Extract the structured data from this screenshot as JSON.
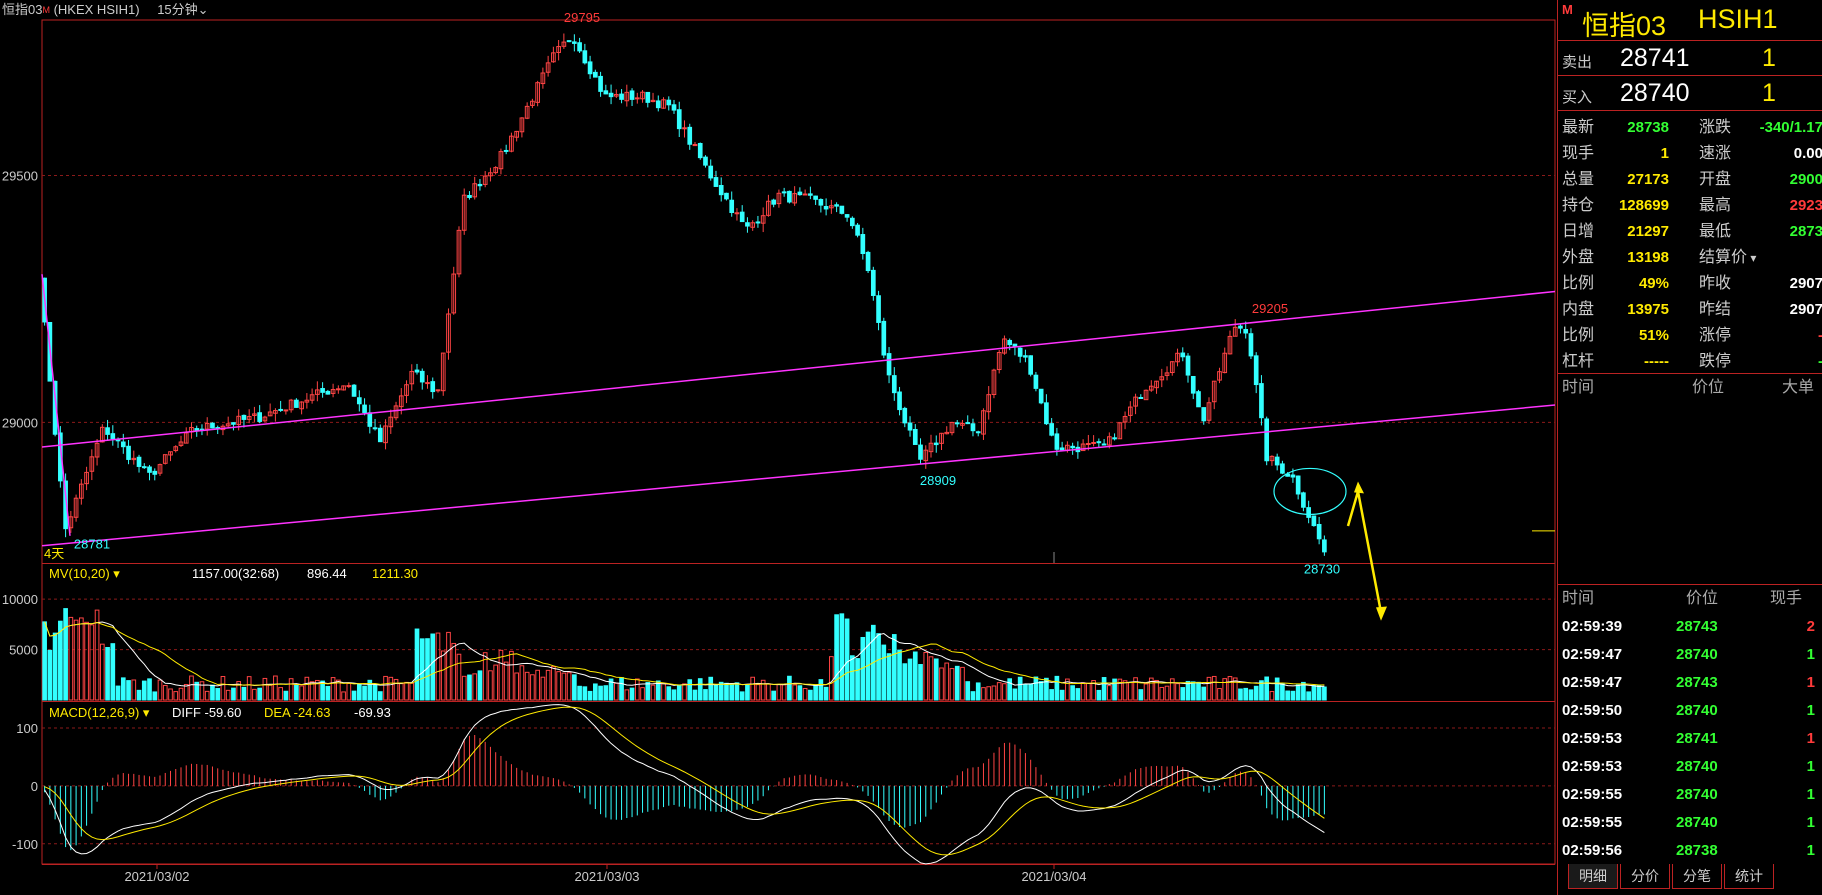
{
  "header": {
    "name": "恒指03",
    "exchange": "(HKEX HSIH1)",
    "period": "15分钟",
    "period_icon": "chevron-down-icon"
  },
  "chart_data": {
    "type": "candlestick",
    "price_axis": {
      "ylim": [
        28715,
        29815
      ],
      "ticks": [
        29000,
        29500
      ]
    },
    "x_labels": [
      "2021/03/02",
      "2021/03/03",
      "2021/03/04"
    ],
    "left_marker": "4天",
    "annotations": [
      {
        "label": "29795",
        "value": 29795,
        "color": "#ff3b3b",
        "anchor": "high"
      },
      {
        "label": "29205",
        "value": 29205,
        "color": "#ff3b3b",
        "anchor": "high"
      },
      {
        "label": "28781",
        "value": 28781,
        "color": "#33ffff",
        "anchor": "low"
      },
      {
        "label": "28909",
        "value": 28909,
        "color": "#33ffff",
        "anchor": "low"
      },
      {
        "label": "28730",
        "value": 28730,
        "color": "#33ffff",
        "anchor": "low"
      }
    ],
    "channel_lines": [
      {
        "name": "upper",
        "color": "#ff33ff",
        "points": [
          [
            0,
            28950
          ],
          [
            1,
            29265
          ]
        ]
      },
      {
        "name": "lower",
        "color": "#ff33ff",
        "points": [
          [
            0,
            28750
          ],
          [
            1,
            29035
          ]
        ]
      }
    ],
    "anchors": [
      {
        "x": 0.0,
        "y": 29300
      },
      {
        "x": 0.02,
        "y": 28781
      },
      {
        "x": 0.05,
        "y": 28990
      },
      {
        "x": 0.085,
        "y": 28890
      },
      {
        "x": 0.12,
        "y": 28985
      },
      {
        "x": 0.17,
        "y": 29010
      },
      {
        "x": 0.24,
        "y": 29080
      },
      {
        "x": 0.265,
        "y": 28960
      },
      {
        "x": 0.29,
        "y": 29100
      },
      {
        "x": 0.31,
        "y": 29060
      },
      {
        "x": 0.33,
        "y": 29450
      },
      {
        "x": 0.36,
        "y": 29540
      },
      {
        "x": 0.4,
        "y": 29740
      },
      {
        "x": 0.415,
        "y": 29785
      },
      {
        "x": 0.44,
        "y": 29660
      },
      {
        "x": 0.47,
        "y": 29660
      },
      {
        "x": 0.49,
        "y": 29640
      },
      {
        "x": 0.52,
        "y": 29510
      },
      {
        "x": 0.55,
        "y": 29390
      },
      {
        "x": 0.575,
        "y": 29460
      },
      {
        "x": 0.6,
        "y": 29450
      },
      {
        "x": 0.63,
        "y": 29420
      },
      {
        "x": 0.645,
        "y": 29310
      },
      {
        "x": 0.66,
        "y": 29100
      },
      {
        "x": 0.685,
        "y": 28920
      },
      {
        "x": 0.71,
        "y": 29000
      },
      {
        "x": 0.73,
        "y": 28980
      },
      {
        "x": 0.75,
        "y": 29170
      },
      {
        "x": 0.77,
        "y": 29120
      },
      {
        "x": 0.79,
        "y": 28950
      },
      {
        "x": 0.83,
        "y": 28950
      },
      {
        "x": 0.86,
        "y": 29070
      },
      {
        "x": 0.89,
        "y": 29140
      },
      {
        "x": 0.905,
        "y": 29000
      },
      {
        "x": 0.93,
        "y": 29195
      },
      {
        "x": 0.94,
        "y": 29190
      },
      {
        "x": 0.955,
        "y": 28930
      },
      {
        "x": 0.975,
        "y": 28890
      },
      {
        "x": 1.0,
        "y": 28738
      }
    ],
    "volume": {
      "label": "MV(10,20)",
      "values_text": [
        "1157.00(32:68)",
        "896.44",
        "1211.30"
      ],
      "ticks": [
        5000,
        10000
      ],
      "ylim": [
        0,
        11500
      ]
    },
    "macd": {
      "label": "MACD(12,26,9)",
      "diff_label": "DIFF -59.60",
      "dea_label": "DEA -24.63",
      "macd_value": "-69.93",
      "ticks": [
        100,
        0,
        -100
      ],
      "ylim": [
        -135,
        145
      ]
    },
    "colors": {
      "up": "#ff4444",
      "down": "#33ffff",
      "ma1": "#ffffff",
      "ma2": "#ffea00",
      "grid": "#8b1a1a"
    }
  },
  "panel": {
    "m_badge": "M",
    "name": "恒指03",
    "code": "HSIH1",
    "ask": {
      "label": "卖出",
      "price": "28741",
      "vol": "1"
    },
    "bid": {
      "label": "买入",
      "price": "28740",
      "vol": "1"
    },
    "stats": [
      {
        "l1": "最新",
        "v1": "28738",
        "c1": "c-grn",
        "l2": "涨跌",
        "v2": "-340/1.17",
        "c2": "c-grn"
      },
      {
        "l1": "现手",
        "v1": "1",
        "c1": "c-yel",
        "l2": "速涨",
        "v2": "0.00",
        "c2": "c-wht"
      },
      {
        "l1": "总量",
        "v1": "27173",
        "c1": "c-yel",
        "l2": "开盘",
        "v2": "2900",
        "c2": "c-grn"
      },
      {
        "l1": "持仓",
        "v1": "128699",
        "c1": "c-yel",
        "l2": "最高",
        "v2": "2923",
        "c2": "c-red"
      },
      {
        "l1": "日增",
        "v1": "21297",
        "c1": "c-yel",
        "l2": "最低",
        "v2": "2873",
        "c2": "c-grn"
      },
      {
        "l1": "外盘",
        "v1": "13198",
        "c1": "c-yel",
        "l2": "结算价",
        "v2": "",
        "c2": "c-wht"
      },
      {
        "l1": "比例",
        "v1": "49%",
        "c1": "c-yel",
        "l2": "昨收",
        "v2": "2907",
        "c2": "c-wht"
      },
      {
        "l1": "内盘",
        "v1": "13975",
        "c1": "c-yel",
        "l2": "昨结",
        "v2": "2907",
        "c2": "c-wht"
      },
      {
        "l1": "比例",
        "v1": "51%",
        "c1": "c-yel",
        "l2": "涨停",
        "v2": "-",
        "c2": "c-red"
      },
      {
        "l1": "杠杆",
        "v1": "-----",
        "c1": "c-yel",
        "l2": "跌停",
        "v2": "-",
        "c2": "c-grn"
      }
    ],
    "big_header": {
      "time": "时间",
      "price": "价位",
      "big": "大单"
    },
    "tick_header": {
      "time": "时间",
      "price": "价位",
      "vol": "现手"
    },
    "ticks": [
      {
        "time": "02:59:39",
        "price": "28743",
        "vol": "2",
        "vc": "c-red"
      },
      {
        "time": "02:59:47",
        "price": "28740",
        "vol": "1",
        "vc": "c-grn"
      },
      {
        "time": "02:59:47",
        "price": "28743",
        "vol": "1",
        "vc": "c-red"
      },
      {
        "time": "02:59:50",
        "price": "28740",
        "vol": "1",
        "vc": "c-grn"
      },
      {
        "time": "02:59:53",
        "price": "28741",
        "vol": "1",
        "vc": "c-red"
      },
      {
        "time": "02:59:53",
        "price": "28740",
        "vol": "1",
        "vc": "c-grn"
      },
      {
        "time": "02:59:55",
        "price": "28740",
        "vol": "1",
        "vc": "c-grn"
      },
      {
        "time": "02:59:55",
        "price": "28740",
        "vol": "1",
        "vc": "c-grn"
      },
      {
        "time": "02:59:56",
        "price": "28738",
        "vol": "1",
        "vc": "c-grn"
      }
    ],
    "tabs": [
      "明细",
      "分价",
      "分笔",
      "统计"
    ]
  }
}
